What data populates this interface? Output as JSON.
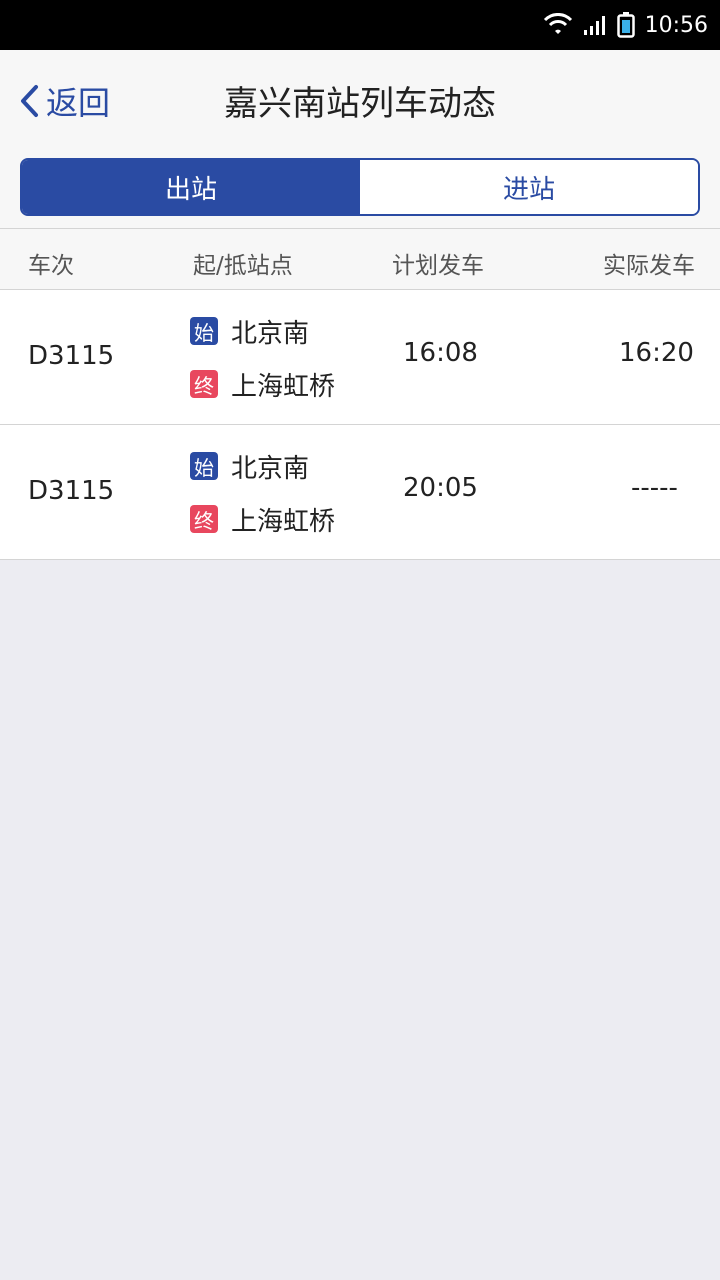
{
  "status_bar": {
    "time": "10:56"
  },
  "nav": {
    "back_label": "返回",
    "title": "嘉兴南站列车动态"
  },
  "tabs": [
    {
      "label": "出站",
      "active": true
    },
    {
      "label": "进站",
      "active": false
    }
  ],
  "table": {
    "headers": [
      "车次",
      "起/抵站点",
      "计划发车",
      "实际发车"
    ],
    "start_tag": "始",
    "end_tag": "终",
    "rows": [
      {
        "train": "D3115",
        "from": "北京南",
        "to": "上海虹桥",
        "planned": "16:08",
        "actual": "16:20"
      },
      {
        "train": "D3115",
        "from": "北京南",
        "to": "上海虹桥",
        "planned": "20:05",
        "actual": "-----"
      }
    ]
  },
  "colors": {
    "accent": "#2a4ba3",
    "end_tag": "#e8475e",
    "background": "#ececf2"
  }
}
